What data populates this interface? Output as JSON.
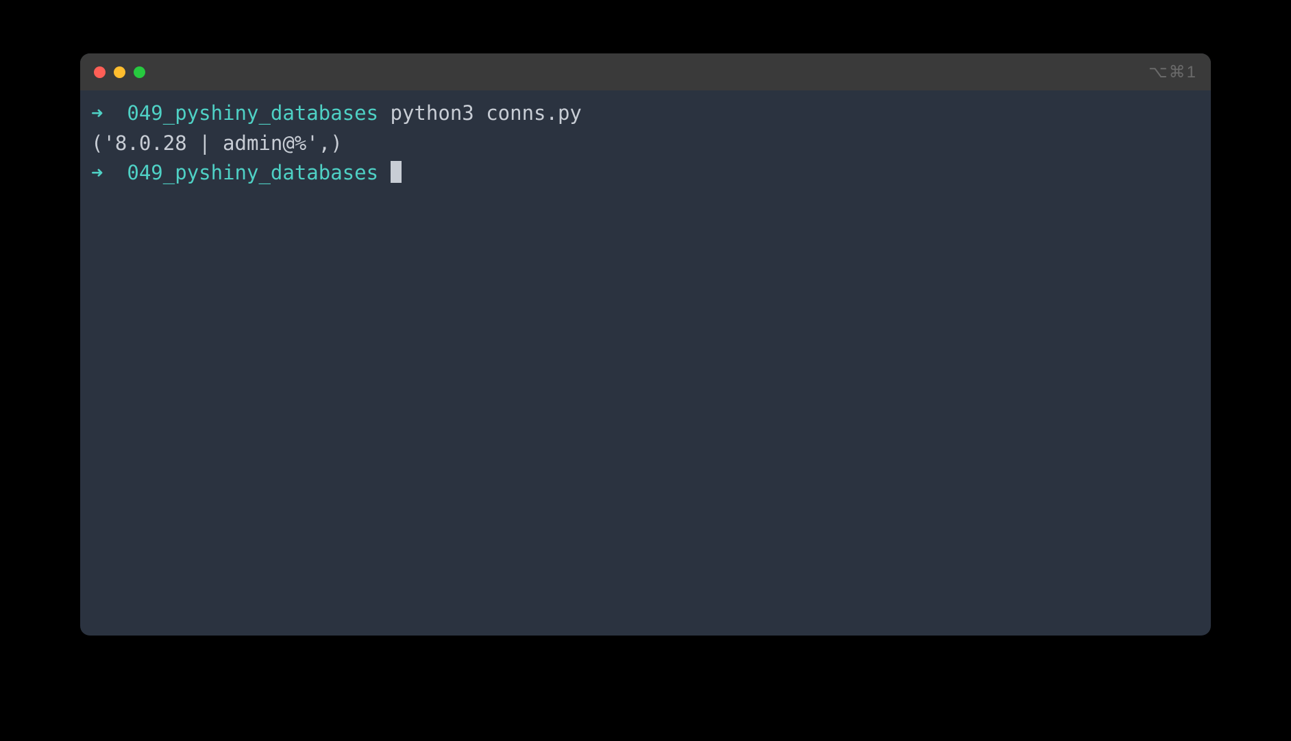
{
  "titlebar": {
    "tab_indicator": "⌥⌘1"
  },
  "terminal": {
    "lines": [
      {
        "prompt_arrow": "➜",
        "directory": "049_pyshiny_databases",
        "command": "python3 conns.py"
      }
    ],
    "output": "('8.0.28 | admin@%',)",
    "current_prompt": {
      "prompt_arrow": "➜",
      "directory": "049_pyshiny_databases"
    }
  }
}
